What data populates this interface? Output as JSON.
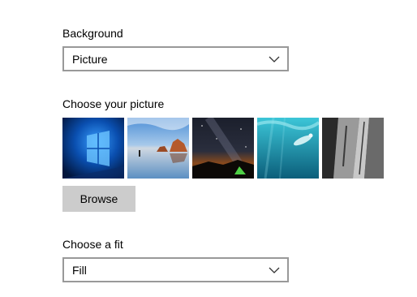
{
  "background": {
    "label": "Background",
    "selected": "Picture"
  },
  "picture": {
    "label": "Choose your picture",
    "thumbnails": [
      {
        "name": "windows-blue-light"
      },
      {
        "name": "beach-rocks"
      },
      {
        "name": "night-sky-tent"
      },
      {
        "name": "underwater-swimmer"
      },
      {
        "name": "rock-cliff-grayscale"
      }
    ],
    "browse_label": "Browse"
  },
  "fit": {
    "label": "Choose a fit",
    "selected": "Fill"
  },
  "colors": {
    "border": "#999999",
    "button": "#cccccc"
  }
}
